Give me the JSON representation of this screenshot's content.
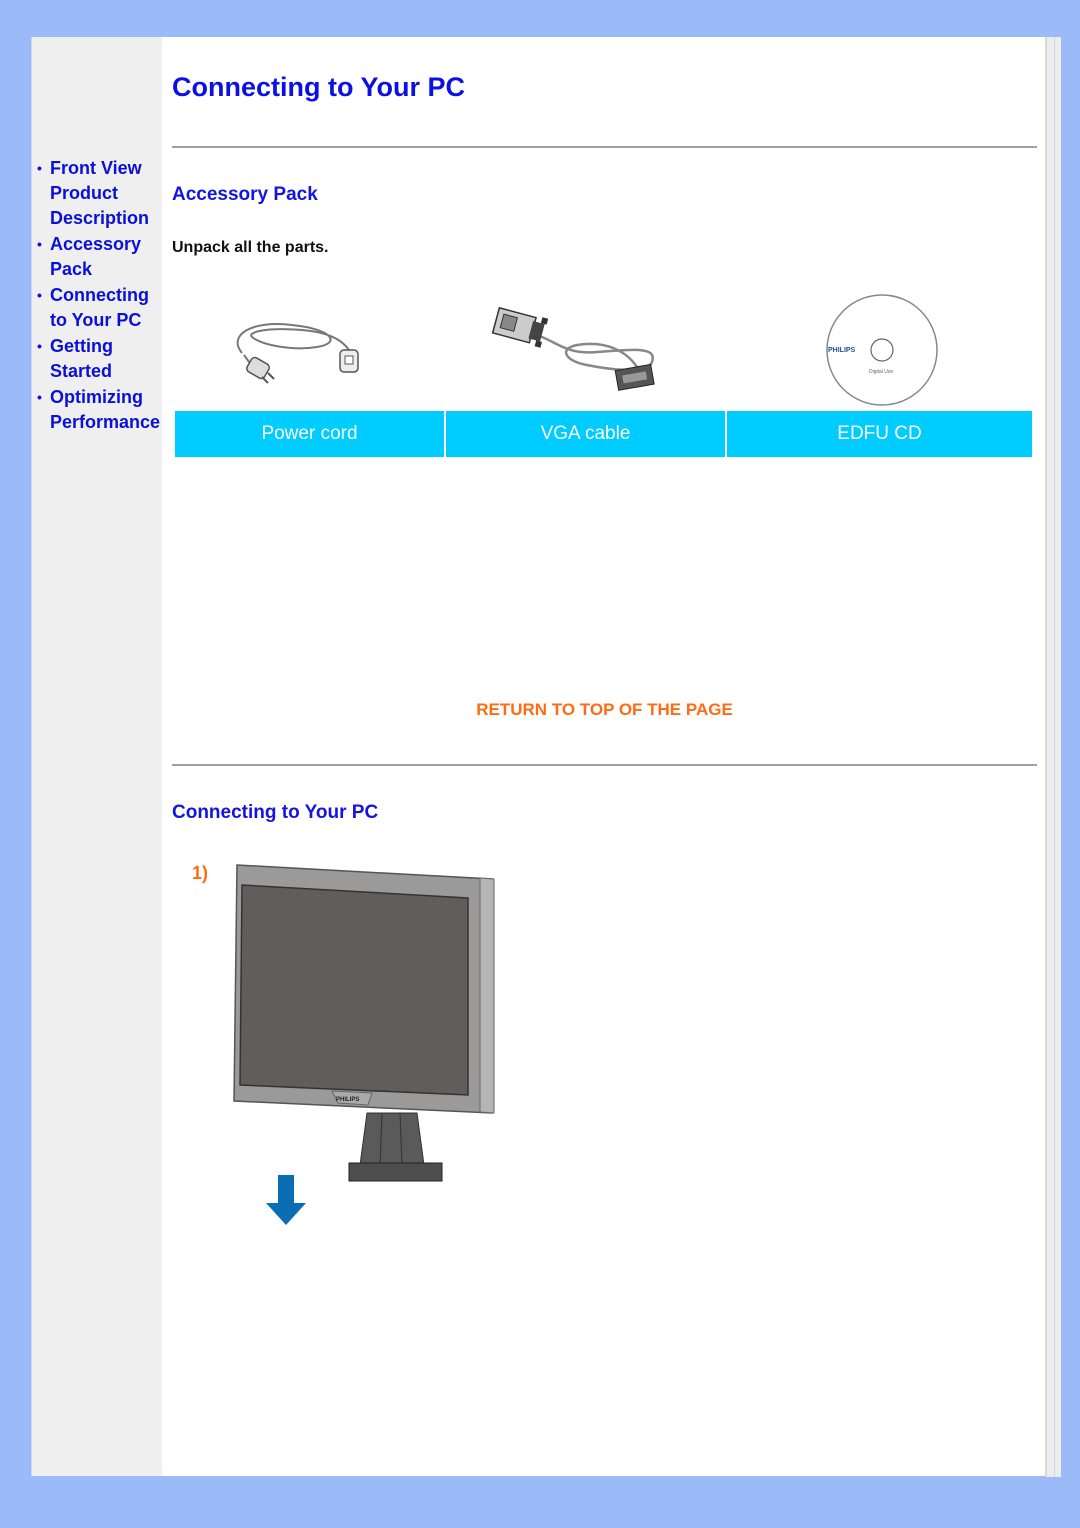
{
  "page": {
    "title": "Connecting to Your PC"
  },
  "sidebar": {
    "items": [
      {
        "label": "Front View Product Description"
      },
      {
        "label": "Accessory Pack"
      },
      {
        "label": "Connecting to Your PC"
      },
      {
        "label": "Getting Started"
      },
      {
        "label": "Optimizing Performance"
      }
    ],
    "bullet": "•"
  },
  "accessory_pack": {
    "title": "Accessory Pack",
    "intro": "Unpack all the parts.",
    "items": [
      {
        "label": "Power cord",
        "icon": "power-cord-icon"
      },
      {
        "label": "VGA cable",
        "icon": "vga-cable-icon"
      },
      {
        "label": "EDFU CD",
        "icon": "cd-icon"
      }
    ],
    "cd_brand": "PHILIPS",
    "cd_text": "Digital Use"
  },
  "return_link": "RETURN TO TOP OF THE PAGE",
  "connecting": {
    "title": "Connecting to Your PC",
    "step": "1)",
    "monitor_brand": "PHILIPS"
  },
  "colors": {
    "background": "#9abbf8",
    "sidebar": "#efefef",
    "heading_blue": "#0a10e6",
    "label_cyan": "#00ccff",
    "accent_orange": "#ff6a13",
    "arrow_blue": "#0b6db4"
  }
}
